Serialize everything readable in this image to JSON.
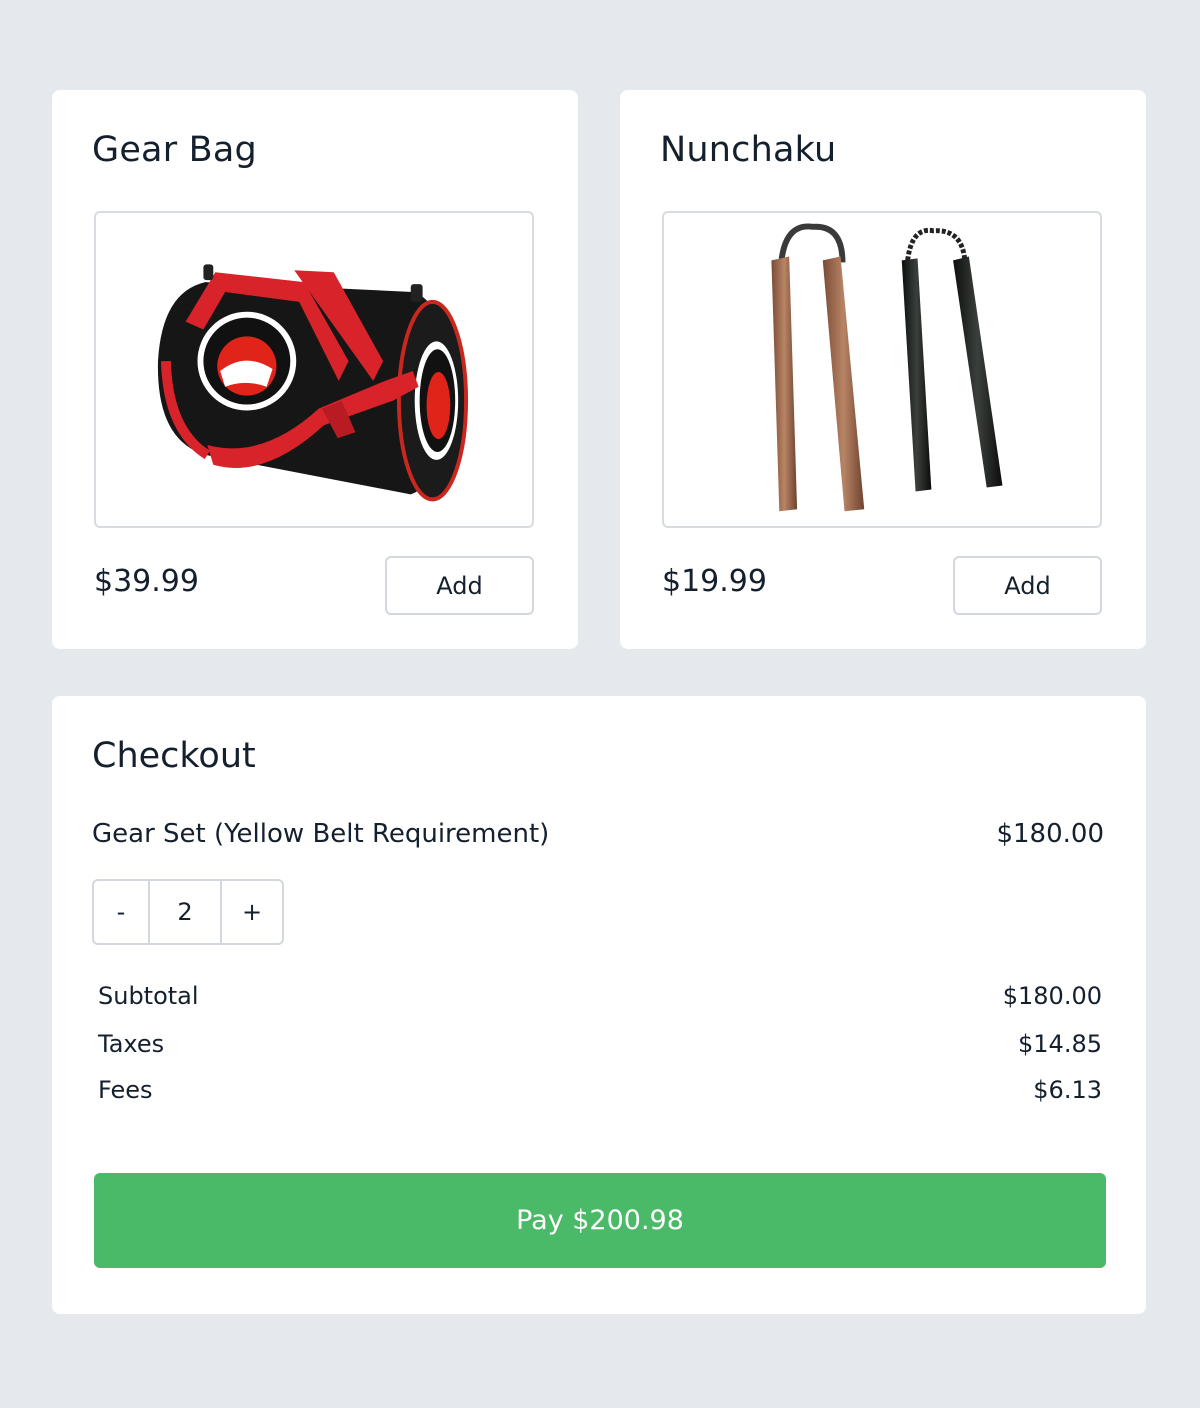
{
  "products": [
    {
      "title": "Gear Bag",
      "price": "$39.99",
      "add_label": "Add",
      "image_alt": "gear-bag-photo"
    },
    {
      "title": "Nunchaku",
      "price": "$19.99",
      "add_label": "Add",
      "image_alt": "nunchaku-photo"
    }
  ],
  "checkout": {
    "title": "Checkout",
    "item_name": "Gear Set (Yellow Belt Requirement)",
    "item_price": "$180.00",
    "quantity": "2",
    "minus_label": "-",
    "plus_label": "+",
    "subtotal_label": "Subtotal",
    "subtotal_value": "$180.00",
    "taxes_label": "Taxes",
    "taxes_value": "$14.85",
    "fees_label": "Fees",
    "fees_value": "$6.13",
    "pay_label": "Pay $200.98"
  },
  "colors": {
    "background": "#e5e9ee",
    "card": "#ffffff",
    "text": "#15202e",
    "pay_button": "#4bba68",
    "border": "#d3d7de"
  }
}
